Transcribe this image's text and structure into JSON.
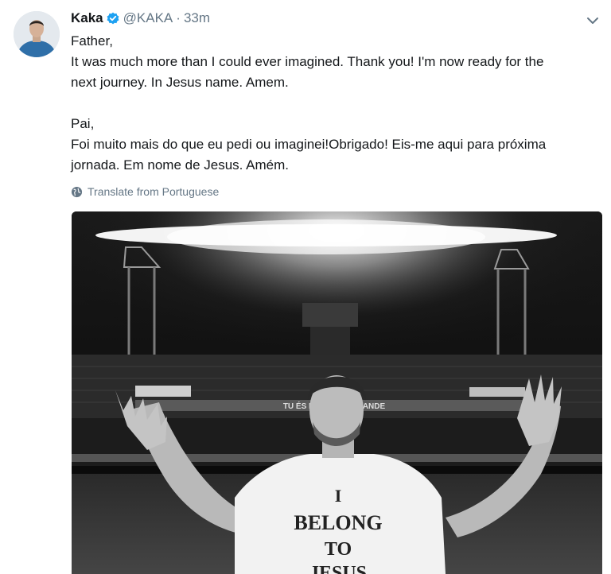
{
  "tweet": {
    "author_name": "Kaka",
    "handle": "@KAKA",
    "separator": "·",
    "time": "33m",
    "lines_en": [
      "Father,",
      "It was much more than I could ever imagined. Thank you! I'm now ready for the",
      "next journey. In Jesus name. Amem."
    ],
    "lines_pt": [
      "Pai,",
      "Foi muito mais do que eu pedi ou imaginei!Obrigado! Eis-me aqui para próxima",
      "jornada. Em nome de Jesus. Amém."
    ],
    "translate_label": "Translate from Portuguese",
    "photo": {
      "banner_text": "TU ÉS FORTE ÉS GRANDE",
      "shirt_line1": "I",
      "shirt_line2": "BELONG",
      "shirt_line3": "TO",
      "shirt_line4": "JESUS"
    }
  },
  "icons": {
    "verified": "verified-badge-icon",
    "caret": "chevron-down-icon",
    "globe": "globe-icon"
  },
  "colors": {
    "text": "#14171a",
    "secondary": "#657786",
    "verified": "#1da1f2"
  }
}
